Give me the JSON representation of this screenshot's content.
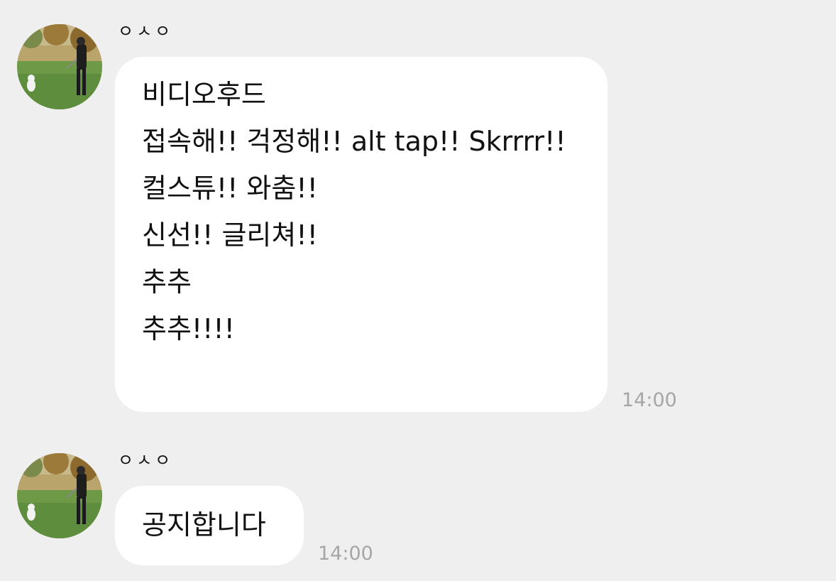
{
  "messages": [
    {
      "sender": "ㅇㅅㅇ",
      "lines": [
        "비디오후드",
        "접속해!! 걱정해!! alt tap!! Skrrrr!!",
        "컬스튜!! 와춤!!",
        "신선!! 글리쳐!!",
        "추추",
        "추추!!!!"
      ],
      "time": "14:00"
    },
    {
      "sender": "ㅇㅅㅇ",
      "lines": [
        "공지합니다"
      ],
      "time": "14:00"
    }
  ],
  "avatar": {
    "icon": "profile-photo-icon"
  }
}
